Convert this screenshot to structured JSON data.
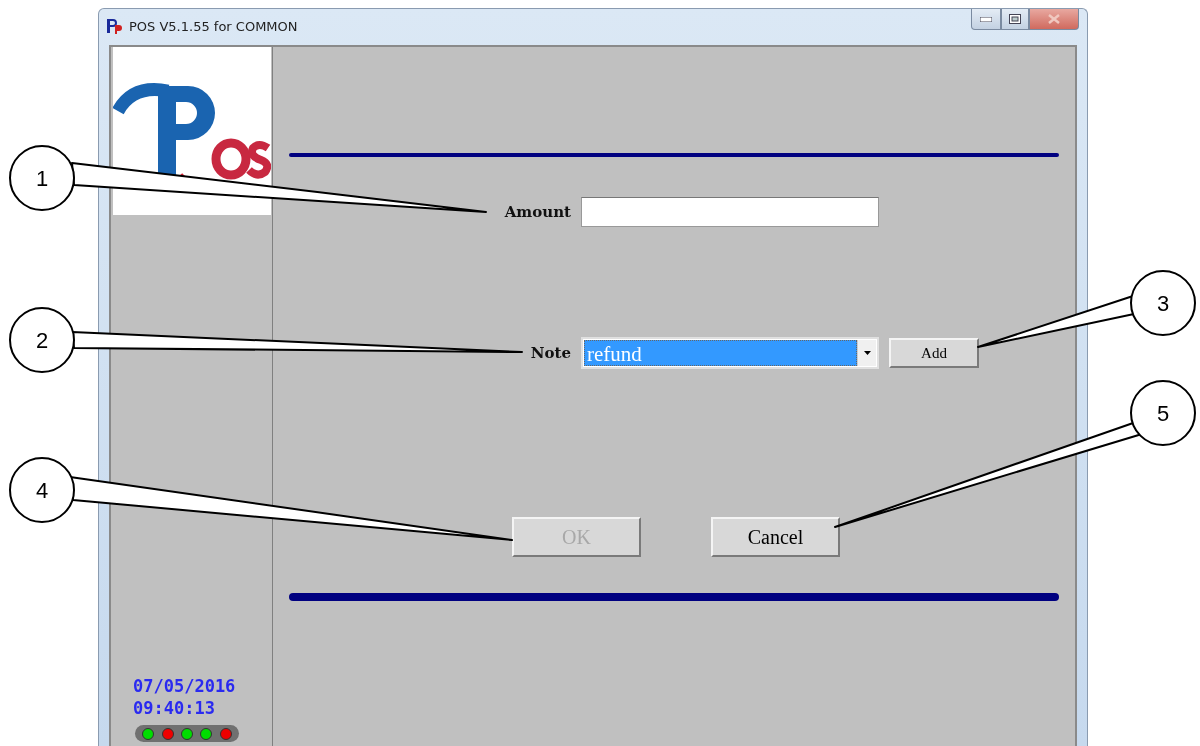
{
  "window": {
    "title": "POS V5.1.55 for COMMON"
  },
  "sidebar": {
    "date": "07/05/2016",
    "time": "09:40:13",
    "leds": [
      {
        "color": "#00dd00"
      },
      {
        "color": "#ee0000"
      },
      {
        "color": "#00dd00"
      },
      {
        "color": "#00dd00"
      },
      {
        "color": "#ee0000"
      }
    ]
  },
  "form": {
    "amount": {
      "label": "Amount"
    },
    "note": {
      "label": "Note",
      "value": "refund",
      "selected": true
    },
    "add_button": "Add",
    "ok_button": {
      "label": "OK",
      "disabled": true
    },
    "cancel_button": {
      "label": "Cancel",
      "disabled": false
    }
  },
  "callouts": [
    "1",
    "2",
    "3",
    "4",
    "5"
  ]
}
